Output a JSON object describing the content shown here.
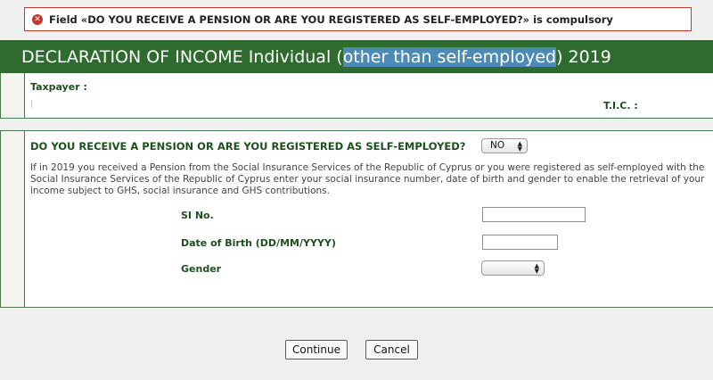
{
  "error": {
    "icon": "error-circle-icon",
    "message": "Field «DO YOU RECEIVE A PENSION OR ARE YOU REGISTERED AS SELF-EMPLOYED?» is compulsory"
  },
  "header": {
    "title_prefix": "DECLARATION OF INCOME Individual (",
    "title_highlight": "other than self-employed",
    "title_suffix": ") 2019"
  },
  "taxpayer_panel": {
    "taxpayer_label": "Taxpayer :",
    "tic_label": "T.I.C. :"
  },
  "pension_panel": {
    "question": "DO YOU RECEIVE A PENSION OR ARE YOU REGISTERED AS SELF-EMPLOYED?",
    "answer_selected": "NO",
    "description": "If in 2019 you received a Pension from the Social Insurance Services of the Republic of Cyprus or you were registered as self-employed with the Social Insurance Services of the Republic of Cyprus enter your social insurance number, date of birth and gender to enable the retrieval of your income subject to GHS, social insurance and GHS contributions.",
    "si_label": "SI No.",
    "si_value": "",
    "dob_label": "Date of Birth (DD/MM/YYYY)",
    "dob_value": "",
    "gender_label": "Gender",
    "gender_selected": ""
  },
  "buttons": {
    "continue_label": "Continue",
    "cancel_label": "Cancel"
  },
  "colors": {
    "header_green": "#2f6b2f",
    "label_green": "#1e4f1e",
    "error_red": "#c0392b",
    "highlight_blue": "#4b8bb5"
  }
}
